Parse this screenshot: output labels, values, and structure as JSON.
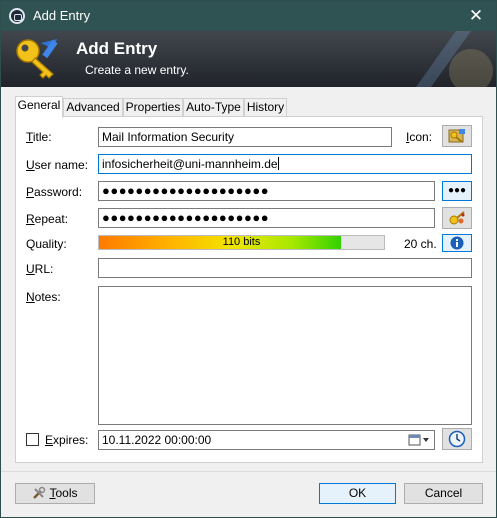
{
  "window": {
    "title": "Add Entry",
    "close_glyph": "✕"
  },
  "banner": {
    "title": "Add Entry",
    "subtitle": "Create a new entry."
  },
  "tabs": [
    {
      "label": "General",
      "active": true
    },
    {
      "label": "Advanced"
    },
    {
      "label": "Properties"
    },
    {
      "label": "Auto-Type"
    },
    {
      "label": "History"
    }
  ],
  "form": {
    "title_label_u": "T",
    "title_label_rest": "itle:",
    "title_value": "Mail Information Security",
    "icon_label_u": "I",
    "icon_label_rest": "con:",
    "username_label_u": "U",
    "username_label_rest": "ser name:",
    "username_value": "infosicherheit@uni-mannheim.de",
    "password_label_u": "P",
    "password_label_rest": "assword:",
    "password_value": "●●●●●●●●●●●●●●●●●●●●",
    "show_password_button": "●●●",
    "repeat_label_u": "R",
    "repeat_label_rest": "epeat:",
    "repeat_value": "●●●●●●●●●●●●●●●●●●●●",
    "quality_label": "Quality:",
    "quality_text": "110 bits",
    "quality_fraction": 0.85,
    "quality_chars": "20 ch.",
    "url_label_u": "U",
    "url_label_rest": "RL:",
    "url_value": "",
    "notes_label_u": "N",
    "notes_label_rest": "otes:",
    "notes_value": "",
    "expires_label_u": "E",
    "expires_label_rest": "xpires:",
    "expires_checked": false,
    "expires_value": "10.11.2022 00:00:00"
  },
  "footer": {
    "tools_label_u": "T",
    "tools_label_rest": "ools",
    "ok_label": "OK",
    "cancel_label": "Cancel"
  },
  "colors": {
    "titlebar": "#2f5252",
    "accent": "#0078d7"
  },
  "icons": [
    "key-icon",
    "entry-icon-picker",
    "generate-password-icon",
    "info-icon",
    "calendar-icon",
    "clock-icon",
    "tools-icon",
    "close-icon"
  ]
}
